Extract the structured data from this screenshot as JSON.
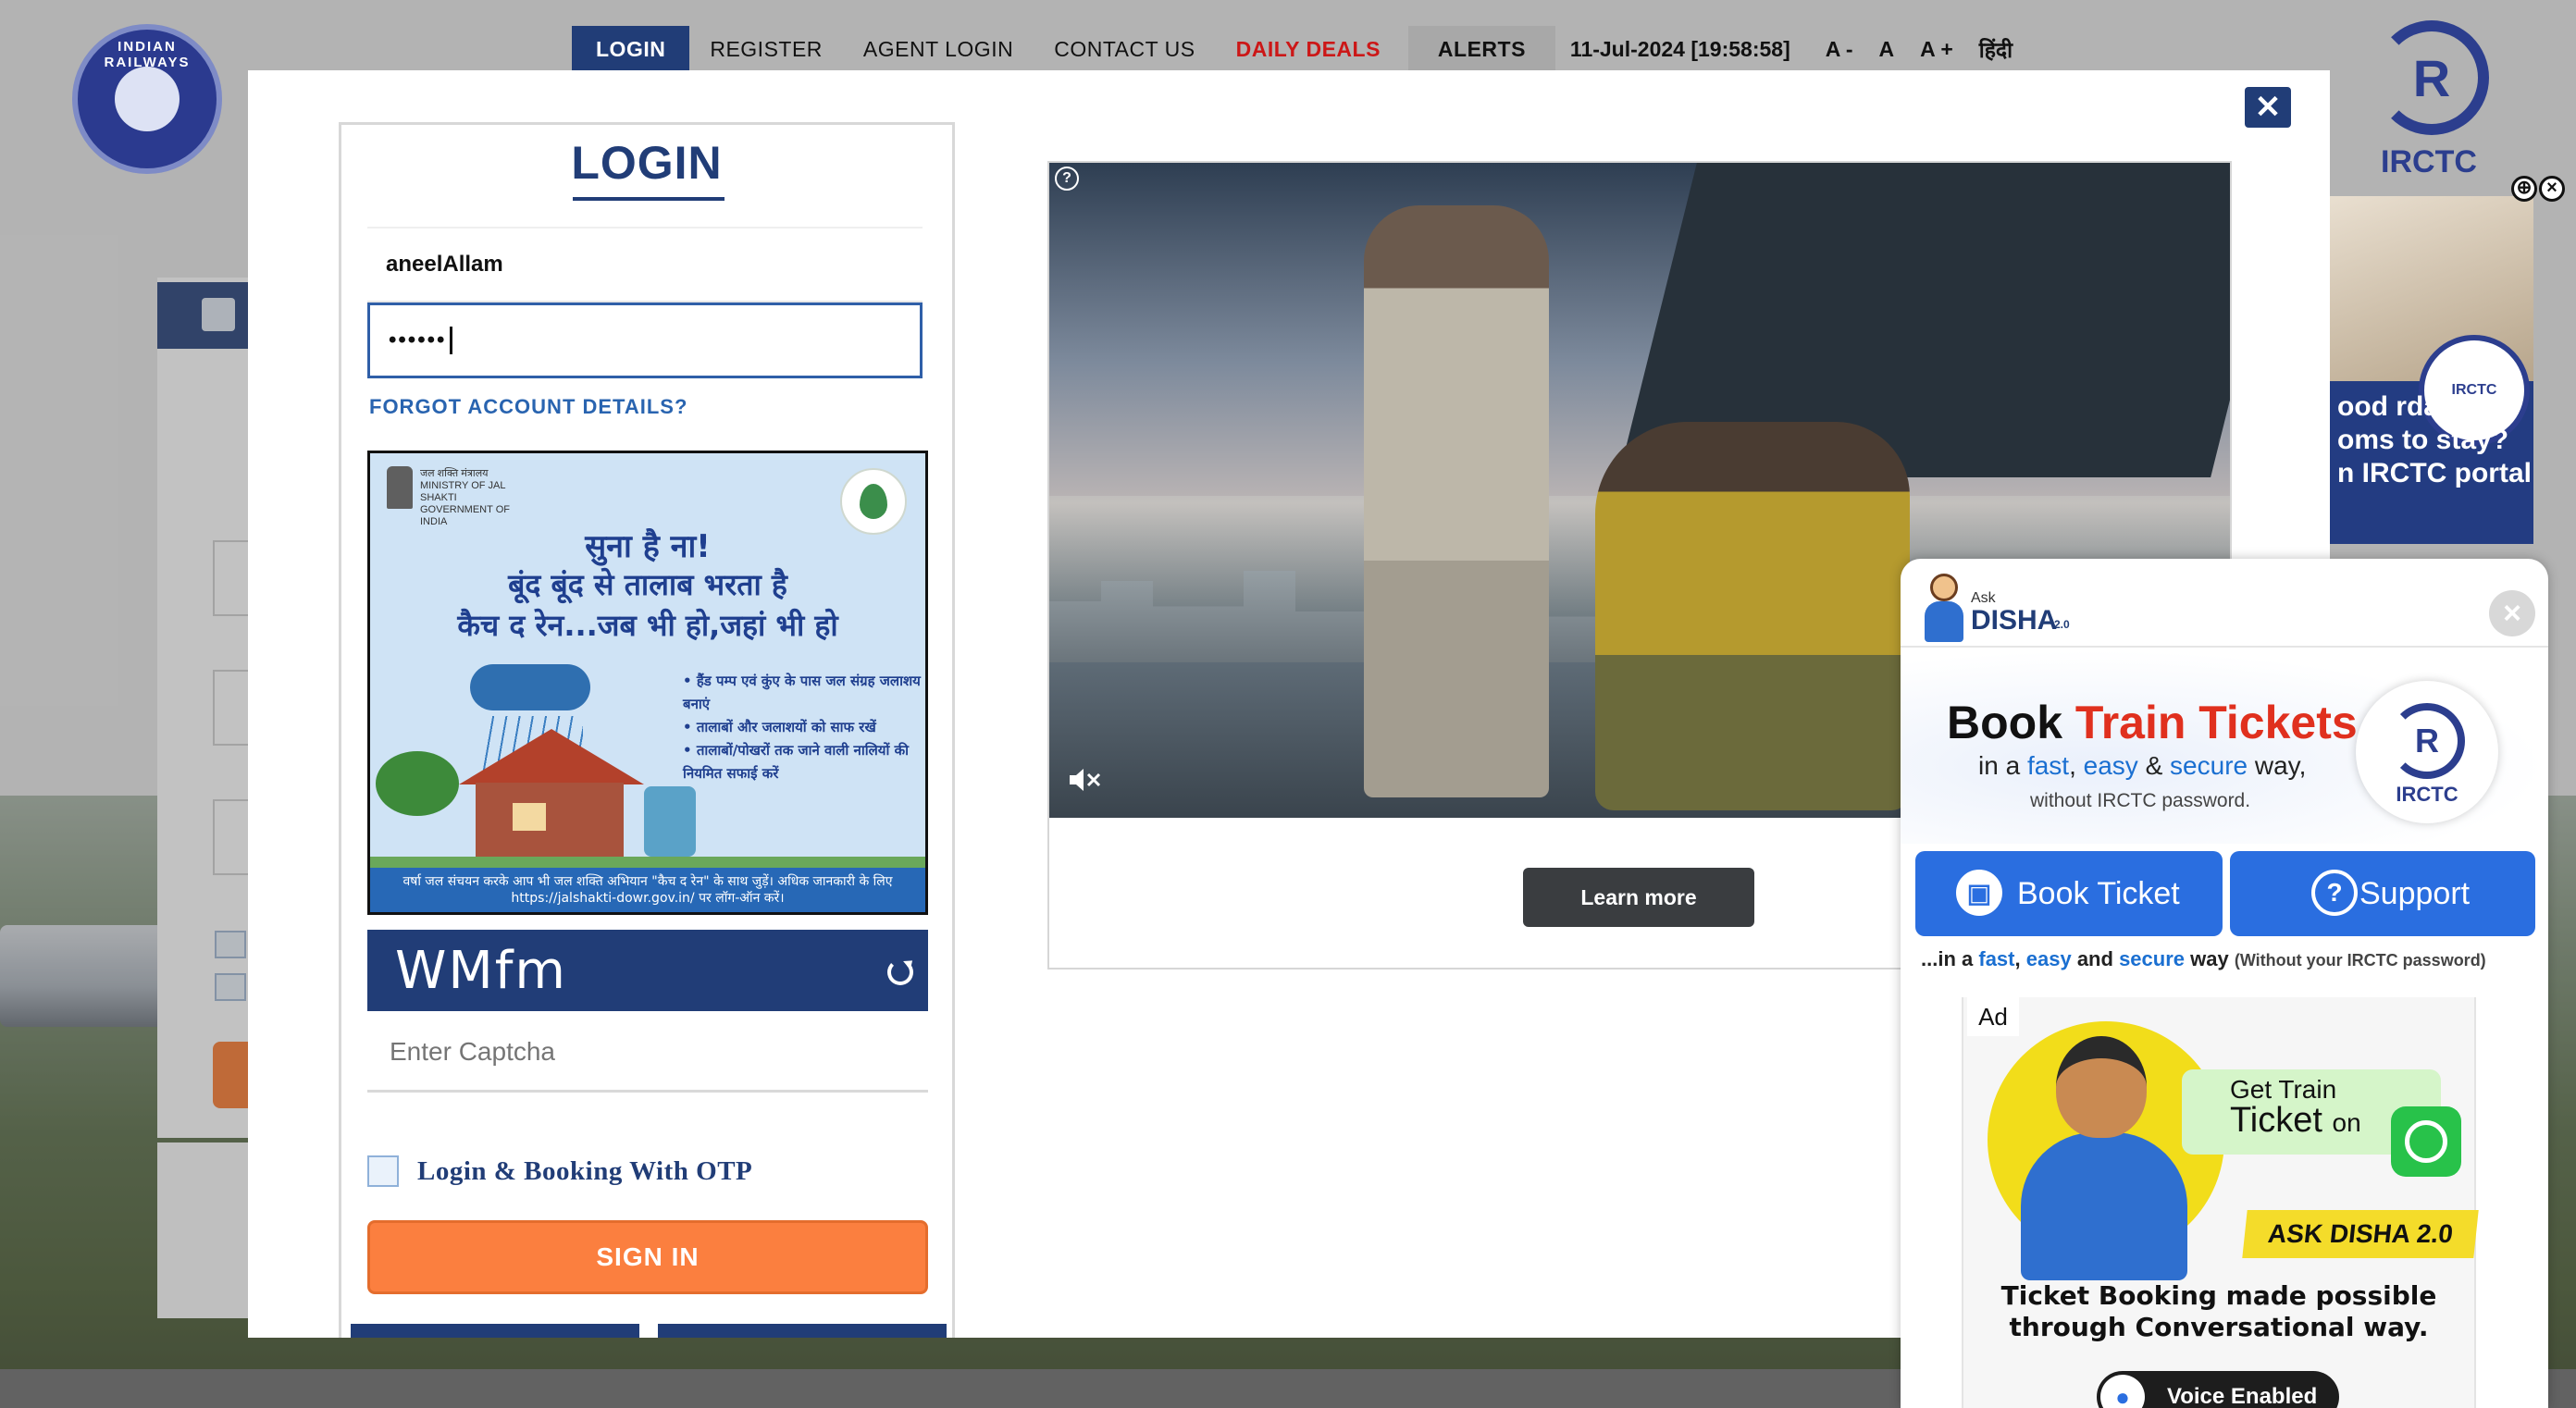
{
  "nav": {
    "items": [
      "LOGIN",
      "REGISTER",
      "AGENT LOGIN",
      "CONTACT US",
      "DAILY DEALS",
      "ALERTS"
    ],
    "datetime": "11-Jul-2024 [19:58:58]",
    "font_small": "A -",
    "font_normal": "A",
    "font_large": "A +",
    "language": "हिंदी"
  },
  "logos": {
    "indian_railways": "INDIAN RAILWAYS",
    "irctc": "IRCTC"
  },
  "side_ad": {
    "text": "ood rdable oms to stay? n IRCTC portal",
    "badge": "IRCTC"
  },
  "login": {
    "title": "LOGIN",
    "username_value": "aneelAllam",
    "password_mask": "••••••",
    "forgot_label": "FORGOT ACCOUNT DETAILS?",
    "captcha_text": "WMfm",
    "captcha_placeholder": "Enter Captcha",
    "otp_label": "Login & Booking With OTP",
    "signin_label": "SIGN IN"
  },
  "captcha_ad": {
    "ministry": "जल शक्ति मंत्रालय MINISTRY OF JAL SHAKTI GOVERNMENT OF INDIA",
    "line1": "सुना है ना!",
    "line2": "बूंद बूंद से तालाब भरता है",
    "line3": "कैच द रेन...जब भी हो,जहां भी हो",
    "bullets": [
      "हैंड पम्प एवं कुंए के पास जल संग्रह जलाशय बनाएं",
      "तालाबों और जलाशयों को साफ रखें",
      "तालाबों/पोखरों तक जाने वाली नालियों की नियमित सफाई करें"
    ],
    "footer": "वर्षा जल संचयन करके आप भी जल शक्ति अभियान \"कैच द रेन\" के साथ जुड़ें। अधिक जानकारी के लिए https://jalshakti-dowr.gov.in/ पर लॉग-ऑन करें।"
  },
  "video_ad": {
    "info": "?",
    "learn_more": "Learn more"
  },
  "disha": {
    "ask": "Ask",
    "name": "DISHA",
    "version": "2.0",
    "headline_book": "Book",
    "headline_rest": "Train Tickets",
    "sub_prefix": "in a",
    "sub_fast": "fast",
    "sub_easy": "easy",
    "sub_amp": "&",
    "sub_secure": "secure",
    "sub_suffix": "way,",
    "no_password": "without IRCTC password.",
    "irctc": "IRCTC",
    "book_btn": "Book Ticket",
    "support_btn": "Support",
    "tag_prefix": "...in a",
    "tag_fast": "fast",
    "tag_easy": "easy",
    "tag_and": "and",
    "tag_secure": "secure",
    "tag_way": "way",
    "tag_note": "(Without your IRCTC password)",
    "ad_label": "Ad",
    "get_train": "Get Train",
    "ticket": "Ticket",
    "on": "on",
    "ask_disha": "ASK DISHA 2.0",
    "ad_text": "Ticket Booking made possible through Conversational way.",
    "voice": "Voice Enabled"
  },
  "colors": {
    "primary": "#213d77",
    "accent_orange": "#fb7f3f",
    "deal_red": "#cc1717",
    "disha_blue": "#2a6ee0"
  }
}
